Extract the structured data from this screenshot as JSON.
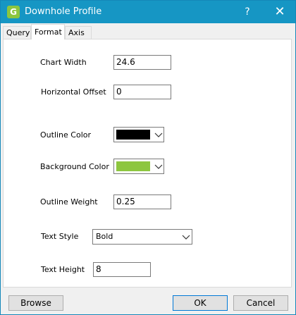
{
  "window": {
    "title": "Downhole Profile",
    "help_glyph": "?",
    "close_glyph": "✕",
    "icon_glyph": "G"
  },
  "tabs": [
    {
      "label": "Query",
      "active": false
    },
    {
      "label": "Format",
      "active": true
    },
    {
      "label": "Axis",
      "active": false
    }
  ],
  "form": {
    "chart_width": {
      "label": "Chart Width",
      "value": "24.6"
    },
    "horizontal_offset": {
      "label": "Horizontal Offset",
      "value": "0"
    },
    "outline_color": {
      "label": "Outline Color",
      "color": "#000000"
    },
    "background_color": {
      "label": "Background Color",
      "color": "#8dc63f"
    },
    "outline_weight": {
      "label": "Outline Weight",
      "value": "0.25"
    },
    "text_style": {
      "label": "Text Style",
      "value": "Bold"
    },
    "text_height": {
      "label": "Text Height",
      "value": "8"
    }
  },
  "buttons": {
    "browse": "Browse",
    "ok": "OK",
    "cancel": "Cancel"
  },
  "colors": {
    "titlebar": "#1696c4",
    "accent_border": "#0078d7"
  }
}
